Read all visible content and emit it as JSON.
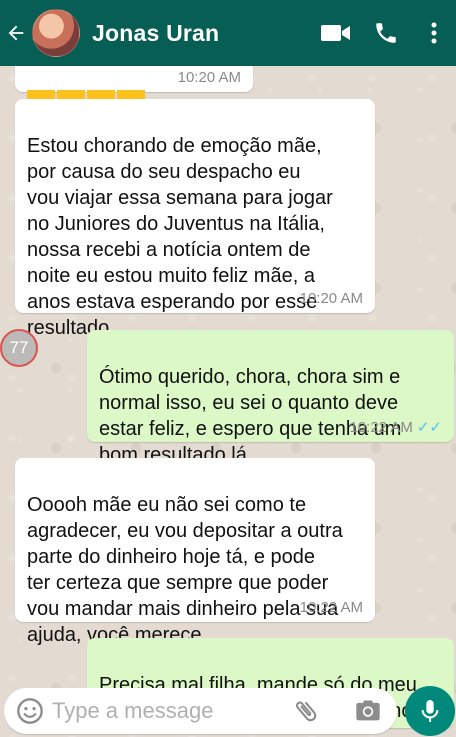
{
  "header": {
    "contact_name": "Jonas Uran",
    "icons": [
      "back-arrow-icon",
      "video-call-icon",
      "phone-icon",
      "more-icon"
    ],
    "bg_color": "#075e54"
  },
  "messages": [
    {
      "direction": "in",
      "text": "",
      "emoji_count": 4,
      "time": "10:20 AM"
    },
    {
      "direction": "in",
      "text": "Estou chorando de emoção mãe,\npor causa do seu despacho eu\nvou viajar essa semana para jogar\nno Juniores do Juventus na Itália,\nnossa recebi a notícia ontem de\nnoite eu estou muito  feliz mãe, a\nanos estava esperando por esse\nresultado.",
      "time": "10:20 AM"
    },
    {
      "direction": "out",
      "text": "Ótimo querido, chora, chora sim e\nnormal isso, eu sei o quanto deve\nestar feliz, e espero que tenha um\nbom resultado lá",
      "time": "10:22 AM",
      "ticks": "✓✓"
    },
    {
      "direction": "in",
      "text": "Ooooh mãe eu não sei como te\nagradecer, eu vou depositar a outra\nparte do dinheiro hoje tá, e pode\nter certeza que sempre que poder\nvou mandar mais dinheiro pela sua\najuda, você merece",
      "time": "10:22 AM"
    },
    {
      "direction": "out",
      "text": "Precisa mal filha, mande só do meu\ntrabalho mesmo, fiz o meu trabalho",
      "time": ""
    }
  ],
  "unread_badge": "77",
  "input": {
    "placeholder": "Type a message"
  },
  "colors": {
    "incoming": "#ffffff",
    "outgoing": "#dcf8c6",
    "accent": "#00897b",
    "read_ticks": "#4fc3f7"
  }
}
